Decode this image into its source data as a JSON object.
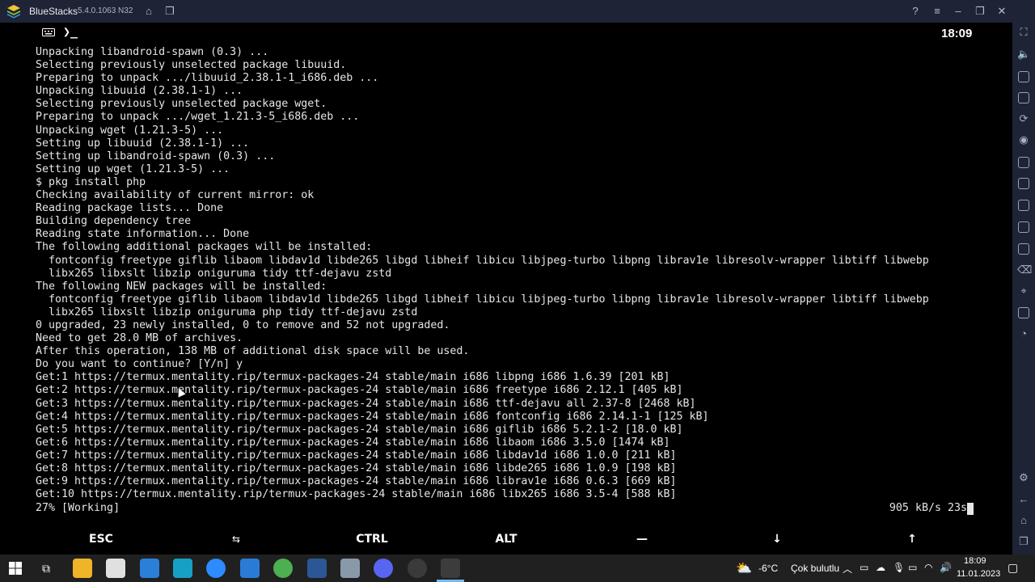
{
  "window": {
    "app_name": "BlueStacks",
    "version": "5.4.0.1063",
    "build_tag": "N32"
  },
  "android": {
    "clock": "18:09"
  },
  "terminal": {
    "lines": [
      "Unpacking libandroid-spawn (0.3) ...",
      "Selecting previously unselected package libuuid.",
      "Preparing to unpack .../libuuid_2.38.1-1_i686.deb ...",
      "Unpacking libuuid (2.38.1-1) ...",
      "Selecting previously unselected package wget.",
      "Preparing to unpack .../wget_1.21.3-5_i686.deb ...",
      "Unpacking wget (1.21.3-5) ...",
      "Setting up libuuid (2.38.1-1) ...",
      "Setting up libandroid-spawn (0.3) ...",
      "Setting up wget (1.21.3-5) ...",
      "$ pkg install php",
      "Checking availability of current mirror: ok",
      "Reading package lists... Done",
      "Building dependency tree",
      "Reading state information... Done",
      "The following additional packages will be installed:",
      "  fontconfig freetype giflib libaom libdav1d libde265 libgd libheif libicu libjpeg-turbo libpng librav1e libresolv-wrapper libtiff libwebp",
      "  libx265 libxslt libzip oniguruma tidy ttf-dejavu zstd",
      "The following NEW packages will be installed:",
      "  fontconfig freetype giflib libaom libdav1d libde265 libgd libheif libicu libjpeg-turbo libpng librav1e libresolv-wrapper libtiff libwebp",
      "  libx265 libxslt libzip oniguruma php tidy ttf-dejavu zstd",
      "0 upgraded, 23 newly installed, 0 to remove and 52 not upgraded.",
      "Need to get 28.0 MB of archives.",
      "After this operation, 138 MB of additional disk space will be used.",
      "Do you want to continue? [Y/n] y",
      "Get:1 https://termux.mentality.rip/termux-packages-24 stable/main i686 libpng i686 1.6.39 [201 kB]",
      "Get:2 https://termux.mentality.rip/termux-packages-24 stable/main i686 freetype i686 2.12.1 [405 kB]",
      "Get:3 https://termux.mentality.rip/termux-packages-24 stable/main i686 ttf-dejavu all 2.37-8 [2468 kB]",
      "Get:4 https://termux.mentality.rip/termux-packages-24 stable/main i686 fontconfig i686 2.14.1-1 [125 kB]",
      "Get:5 https://termux.mentality.rip/termux-packages-24 stable/main i686 giflib i686 5.2.1-2 [18.0 kB]",
      "Get:6 https://termux.mentality.rip/termux-packages-24 stable/main i686 libaom i686 3.5.0 [1474 kB]",
      "Get:7 https://termux.mentality.rip/termux-packages-24 stable/main i686 libdav1d i686 1.0.0 [211 kB]",
      "Get:8 https://termux.mentality.rip/termux-packages-24 stable/main i686 libde265 i686 1.0.9 [198 kB]",
      "Get:9 https://termux.mentality.rip/termux-packages-24 stable/main i686 librav1e i686 0.6.3 [669 kB]",
      "Get:10 https://termux.mentality.rip/termux-packages-24 stable/main i686 libx265 i686 3.5-4 [588 kB]"
    ],
    "progress_left": "27% [Working]",
    "progress_right": "905 kB/s 23s"
  },
  "extra_keys": {
    "esc": "ESC",
    "tab": "⇆",
    "ctrl": "CTRL",
    "alt": "ALT",
    "dash": "—",
    "down": "↓",
    "up": "↑"
  },
  "taskbar": {
    "weather_temp": "-6°C",
    "weather_text": "Çok bulutlu",
    "time": "18:09",
    "date": "11.01.2023"
  },
  "colors": {
    "titlebar_bg": "#1f2336",
    "terminal_bg": "#000000",
    "terminal_fg": "#e6e6e6",
    "taskbar_bg": "#202020"
  }
}
